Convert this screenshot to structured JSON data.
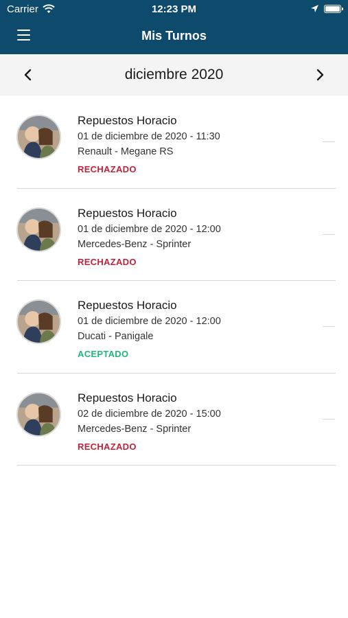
{
  "status_bar": {
    "carrier": "Carrier",
    "time": "12:23 PM"
  },
  "nav": {
    "title": "Mis Turnos",
    "menu_icon": "hamburger-icon"
  },
  "month_selector": {
    "label": "diciembre 2020",
    "prev_icon": "chevron-left-icon",
    "next_icon": "chevron-right-icon"
  },
  "colors": {
    "nav_bg": "#0d4a6c",
    "rejected": "#c0223a",
    "accepted": "#1fb878"
  },
  "appointments": [
    {
      "name": "Repuestos Horacio",
      "datetime": "01 de diciembre de 2020 - 11:30",
      "vehicle": "Renault - Megane RS",
      "status": "RECHAZADO",
      "status_color": "#c0223a"
    },
    {
      "name": "Repuestos Horacio",
      "datetime": "01 de diciembre de 2020 - 12:00",
      "vehicle": "Mercedes-Benz - Sprinter",
      "status": "RECHAZADO",
      "status_color": "#c0223a"
    },
    {
      "name": "Repuestos Horacio",
      "datetime": "01 de diciembre de 2020 - 12:00",
      "vehicle": "Ducati - Panigale",
      "status": "ACEPTADO",
      "status_color": "#1fb878"
    },
    {
      "name": "Repuestos Horacio",
      "datetime": "02 de diciembre de 2020 - 15:00",
      "vehicle": "Mercedes-Benz - Sprinter",
      "status": "RECHAZADO",
      "status_color": "#c0223a"
    }
  ]
}
